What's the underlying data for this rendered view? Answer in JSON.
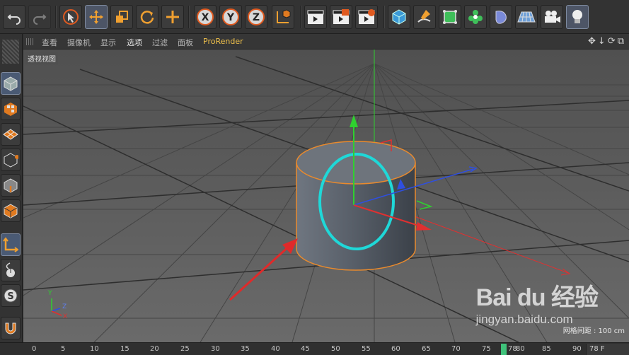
{
  "viewport_menu": {
    "items": [
      "查看",
      "摄像机",
      "显示",
      "选项",
      "过滤",
      "面板",
      "ProRender"
    ],
    "icons": "✥↓⟳⧉"
  },
  "viewport": {
    "label": "透视视图",
    "grid_info": "网格间距 : 100 cm"
  },
  "axis_indicator": {
    "y": "Y",
    "z": "Z",
    "x": "X"
  },
  "timeline": {
    "ticks": [
      "0",
      "5",
      "10",
      "15",
      "20",
      "25",
      "30",
      "35",
      "40",
      "45",
      "50",
      "55",
      "60",
      "65",
      "70",
      "75",
      "78",
      "80",
      "85",
      "90"
    ],
    "current_frame": "78 F"
  },
  "watermark": {
    "logo": "Bai du 经验",
    "url": "jingyan.baidu.com"
  },
  "colors": {
    "accent_orange": "#e98a2d",
    "selection_cyan": "#1fd8d8",
    "annotation_red": "#e02a2a",
    "axis_x": "#e03030",
    "axis_y": "#30d030",
    "axis_z": "#2f4fe0"
  },
  "toolbar_icons": [
    "undo-icon",
    "redo-icon",
    "live-select-icon",
    "move-icon",
    "scale-icon",
    "rotate-icon",
    "add-transform-icon",
    "x-axis-lock-icon",
    "y-axis-lock-icon",
    "z-axis-lock-icon",
    "world-coordinate-icon",
    "render-view-icon",
    "render-picture-viewer-icon",
    "render-settings-icon",
    "cube-object-icon",
    "pen-spline-icon",
    "subdivision-icon",
    "cloner-icon",
    "deformer-icon",
    "floor-icon",
    "camera-icon",
    "light-icon"
  ]
}
